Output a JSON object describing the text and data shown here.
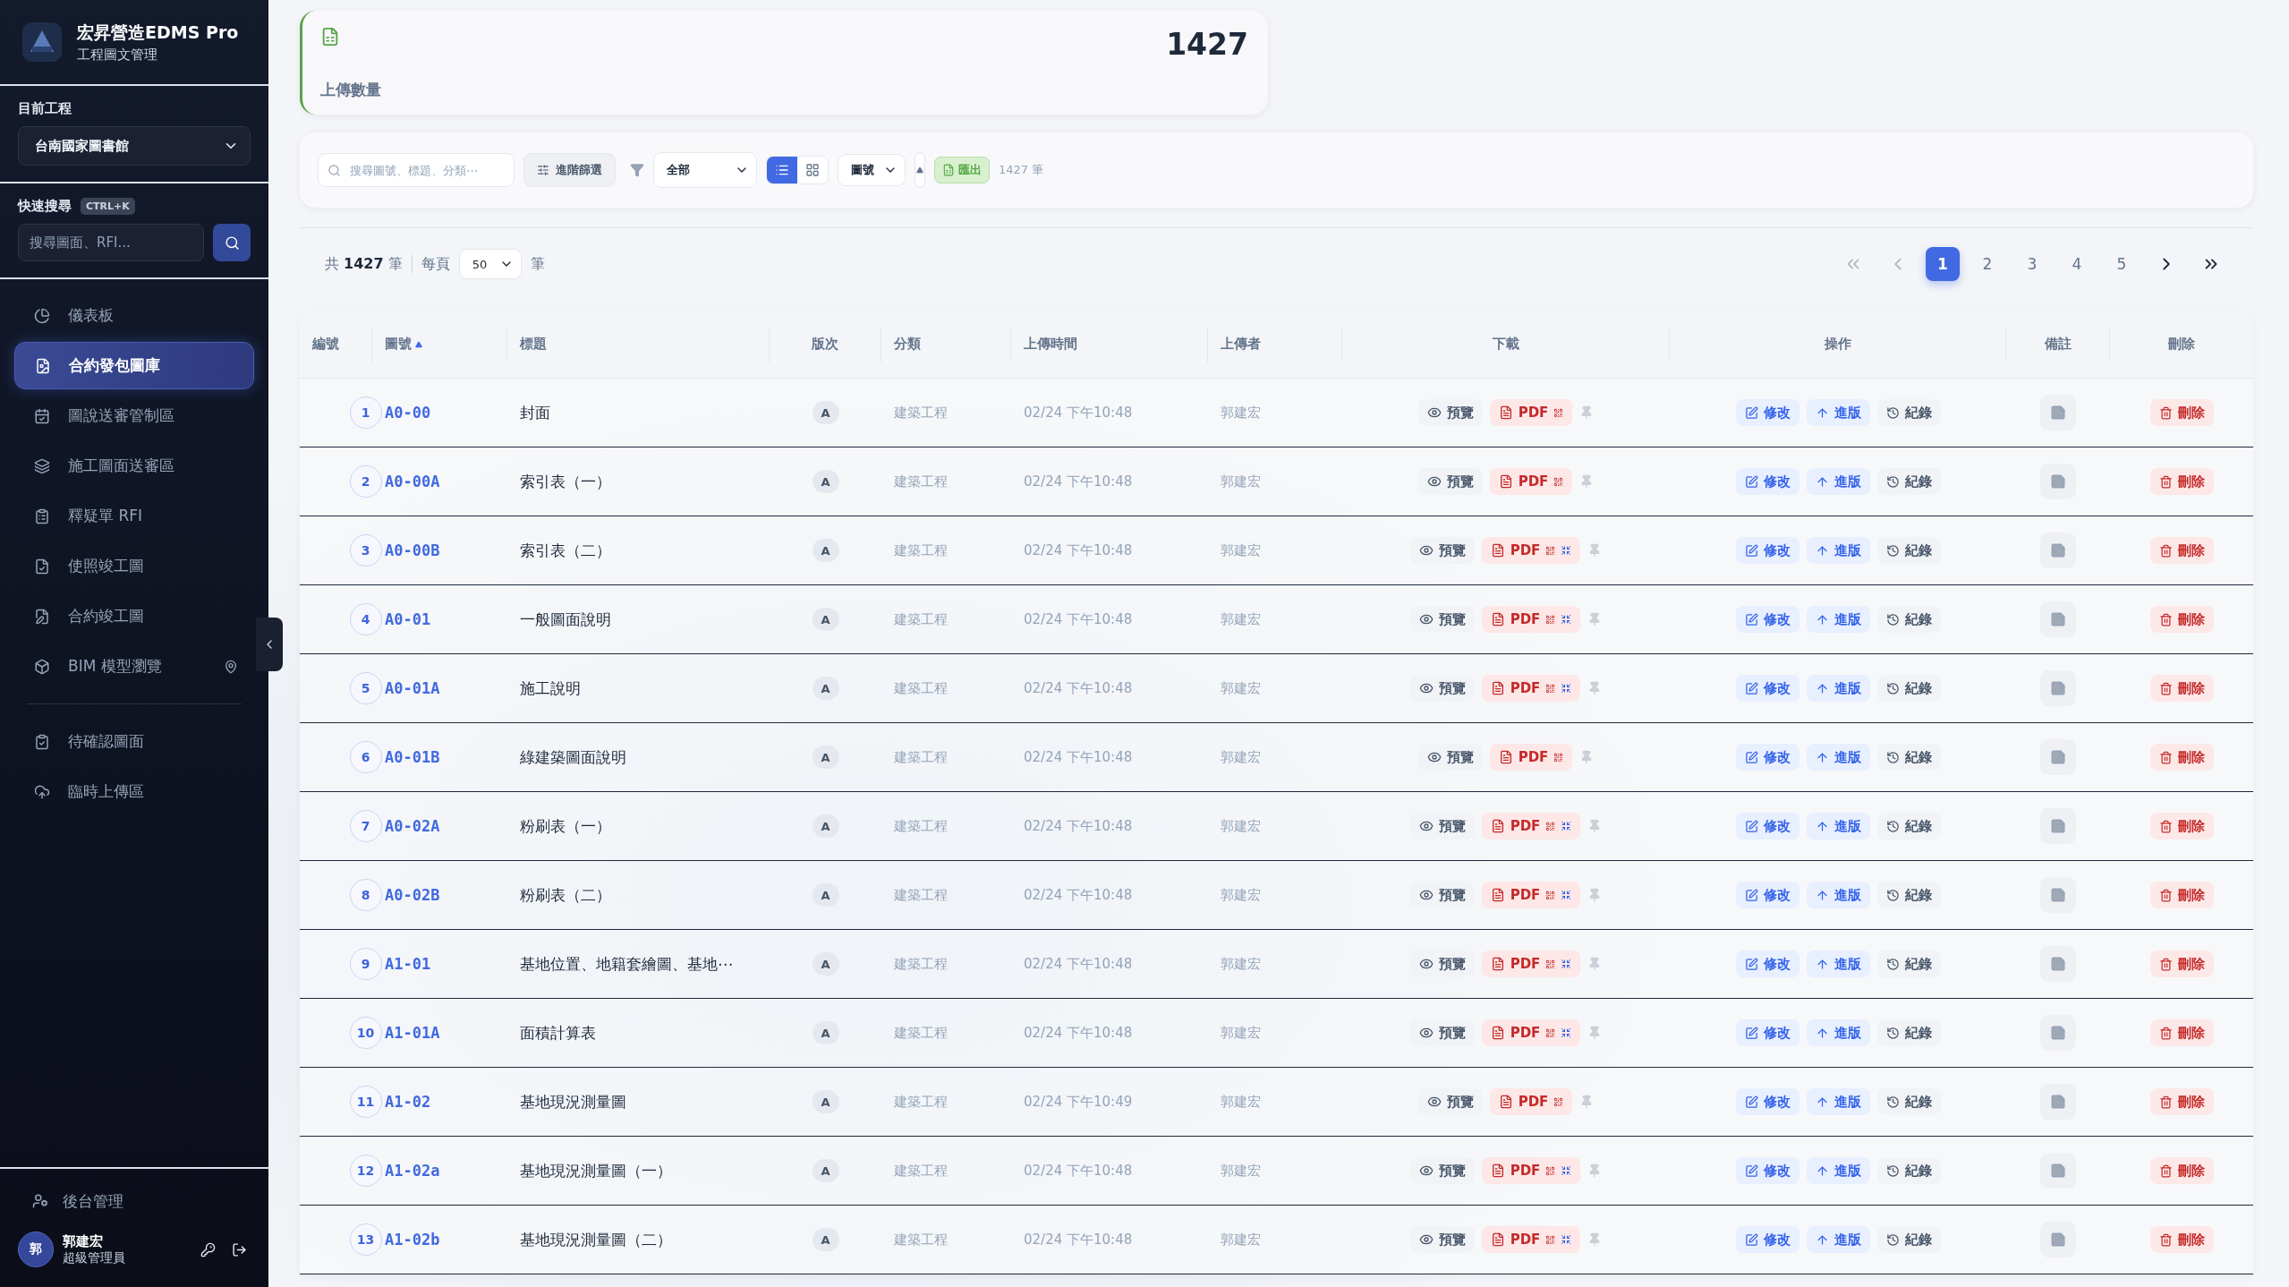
{
  "app": {
    "name": "宏昇營造EDMS Pro",
    "subtitle": "工程圖文管理"
  },
  "project": {
    "label": "目前工程",
    "value": "台南國家圖書館"
  },
  "quick_search": {
    "label": "快速搜尋",
    "shortcut": "CTRL+K",
    "placeholder": "搜尋圖面、RFI..."
  },
  "nav": [
    {
      "kind": "pie",
      "label": "儀表板",
      "selected": false,
      "locate": false
    },
    {
      "kind": "file",
      "label": "合約發包圖庫",
      "selected": true,
      "locate": false
    },
    {
      "kind": "calendar",
      "label": "圖說送審管制區",
      "selected": false,
      "locate": false
    },
    {
      "kind": "layers",
      "label": "施工圖面送審區",
      "selected": false,
      "locate": false
    },
    {
      "kind": "question",
      "label": "釋疑單 RFI",
      "selected": false,
      "locate": false
    },
    {
      "kind": "filecheck",
      "label": "使照竣工圖",
      "selected": false,
      "locate": false
    },
    {
      "kind": "filepen",
      "label": "合約竣工圖",
      "selected": false,
      "locate": false
    },
    {
      "kind": "cube",
      "label": "BIM 模型瀏覽",
      "selected": false,
      "locate": true
    }
  ],
  "nav_secondary": [
    {
      "kind": "clipboard",
      "label": "待確認圖面",
      "selected": false,
      "locate": false
    },
    {
      "kind": "cloud",
      "label": "臨時上傳區",
      "selected": false,
      "locate": false
    }
  ],
  "admin": {
    "label": "後台管理"
  },
  "user": {
    "initial": "郭",
    "name": "郭建宏",
    "role": "超級管理員"
  },
  "stat": {
    "value": "1427",
    "label": "上傳數量"
  },
  "toolbar": {
    "search_placeholder": "搜尋圖號、標題、分類⋯",
    "advanced": "進階篩選",
    "filter": "全部",
    "views": [
      {
        "kind": "list",
        "selected": true
      },
      {
        "kind": "grid",
        "selected": false
      }
    ],
    "sort": "圖號",
    "export": "匯出",
    "count": "1427 筆"
  },
  "summary": {
    "prefix": "共",
    "total": "1427",
    "unit": "筆",
    "per_page_label": "每頁",
    "per_page": "50",
    "per_page_unit": "筆"
  },
  "pagination": {
    "back": [
      {
        "kind": "first",
        "disabled": true
      },
      {
        "kind": "prev",
        "disabled": true
      }
    ],
    "pages": [
      {
        "label": "1",
        "selected": true
      },
      {
        "label": "2",
        "selected": false
      },
      {
        "label": "3",
        "selected": false
      },
      {
        "label": "4",
        "selected": false
      },
      {
        "label": "5",
        "selected": false
      }
    ],
    "forward": [
      {
        "kind": "next",
        "disabled": false
      },
      {
        "kind": "last",
        "disabled": false
      }
    ]
  },
  "table": {
    "columns": [
      {
        "label": "編號",
        "sorted": false
      },
      {
        "label": "圖號",
        "sorted": true
      },
      {
        "label": "標題",
        "sorted": false
      },
      {
        "label": "版次",
        "sorted": false
      },
      {
        "label": "分類",
        "sorted": false
      },
      {
        "label": "上傳時間",
        "sorted": false
      },
      {
        "label": "上傳者",
        "sorted": false
      },
      {
        "label": "下載",
        "sorted": false
      },
      {
        "label": "操作",
        "sorted": false
      },
      {
        "label": "備註",
        "sorted": false
      },
      {
        "label": "刪除",
        "sorted": false
      }
    ],
    "rows": [
      {
        "no": "1",
        "code": "A0-00",
        "title": "封面",
        "rev": "A",
        "category": "建築工程",
        "time": "02/24 下午10:48",
        "uploader": "郭建宏",
        "preview": "預覽",
        "pdf": "PDF",
        "compressed": false,
        "edit": "修改",
        "revise": "進版",
        "log": "紀錄",
        "delete": "刪除"
      },
      {
        "no": "2",
        "code": "A0-00A",
        "title": "索引表（一）",
        "rev": "A",
        "category": "建築工程",
        "time": "02/24 下午10:48",
        "uploader": "郭建宏",
        "preview": "預覽",
        "pdf": "PDF",
        "compressed": false,
        "edit": "修改",
        "revise": "進版",
        "log": "紀錄",
        "delete": "刪除"
      },
      {
        "no": "3",
        "code": "A0-00B",
        "title": "索引表（二）",
        "rev": "A",
        "category": "建築工程",
        "time": "02/24 下午10:48",
        "uploader": "郭建宏",
        "preview": "預覽",
        "pdf": "PDF",
        "compressed": true,
        "edit": "修改",
        "revise": "進版",
        "log": "紀錄",
        "delete": "刪除"
      },
      {
        "no": "4",
        "code": "A0-01",
        "title": "一般圖面說明",
        "rev": "A",
        "category": "建築工程",
        "time": "02/24 下午10:48",
        "uploader": "郭建宏",
        "preview": "預覽",
        "pdf": "PDF",
        "compressed": true,
        "edit": "修改",
        "revise": "進版",
        "log": "紀錄",
        "delete": "刪除"
      },
      {
        "no": "5",
        "code": "A0-01A",
        "title": "施工說明",
        "rev": "A",
        "category": "建築工程",
        "time": "02/24 下午10:48",
        "uploader": "郭建宏",
        "preview": "預覽",
        "pdf": "PDF",
        "compressed": true,
        "edit": "修改",
        "revise": "進版",
        "log": "紀錄",
        "delete": "刪除"
      },
      {
        "no": "6",
        "code": "A0-01B",
        "title": "綠建築圖面說明",
        "rev": "A",
        "category": "建築工程",
        "time": "02/24 下午10:48",
        "uploader": "郭建宏",
        "preview": "預覽",
        "pdf": "PDF",
        "compressed": false,
        "edit": "修改",
        "revise": "進版",
        "log": "紀錄",
        "delete": "刪除"
      },
      {
        "no": "7",
        "code": "A0-02A",
        "title": "粉刷表（一）",
        "rev": "A",
        "category": "建築工程",
        "time": "02/24 下午10:48",
        "uploader": "郭建宏",
        "preview": "預覽",
        "pdf": "PDF",
        "compressed": true,
        "edit": "修改",
        "revise": "進版",
        "log": "紀錄",
        "delete": "刪除"
      },
      {
        "no": "8",
        "code": "A0-02B",
        "title": "粉刷表（二）",
        "rev": "A",
        "category": "建築工程",
        "time": "02/24 下午10:48",
        "uploader": "郭建宏",
        "preview": "預覽",
        "pdf": "PDF",
        "compressed": true,
        "edit": "修改",
        "revise": "進版",
        "log": "紀錄",
        "delete": "刪除"
      },
      {
        "no": "9",
        "code": "A1-01",
        "title": "基地位置、地籍套繪圖、基地⋯",
        "rev": "A",
        "category": "建築工程",
        "time": "02/24 下午10:48",
        "uploader": "郭建宏",
        "preview": "預覽",
        "pdf": "PDF",
        "compressed": true,
        "edit": "修改",
        "revise": "進版",
        "log": "紀錄",
        "delete": "刪除"
      },
      {
        "no": "10",
        "code": "A1-01A",
        "title": "面積計算表",
        "rev": "A",
        "category": "建築工程",
        "time": "02/24 下午10:48",
        "uploader": "郭建宏",
        "preview": "預覽",
        "pdf": "PDF",
        "compressed": true,
        "edit": "修改",
        "revise": "進版",
        "log": "紀錄",
        "delete": "刪除"
      },
      {
        "no": "11",
        "code": "A1-02",
        "title": "基地現況測量圖",
        "rev": "A",
        "category": "建築工程",
        "time": "02/24 下午10:49",
        "uploader": "郭建宏",
        "preview": "預覽",
        "pdf": "PDF",
        "compressed": false,
        "edit": "修改",
        "revise": "進版",
        "log": "紀錄",
        "delete": "刪除"
      },
      {
        "no": "12",
        "code": "A1-02a",
        "title": "基地現況測量圖（一）",
        "rev": "A",
        "category": "建築工程",
        "time": "02/24 下午10:48",
        "uploader": "郭建宏",
        "preview": "預覽",
        "pdf": "PDF",
        "compressed": true,
        "edit": "修改",
        "revise": "進版",
        "log": "紀錄",
        "delete": "刪除"
      },
      {
        "no": "13",
        "code": "A1-02b",
        "title": "基地現況測量圖（二）",
        "rev": "A",
        "category": "建築工程",
        "time": "02/24 下午10:48",
        "uploader": "郭建宏",
        "preview": "預覽",
        "pdf": "PDF",
        "compressed": true,
        "edit": "修改",
        "revise": "進版",
        "log": "紀錄",
        "delete": "刪除"
      }
    ]
  }
}
